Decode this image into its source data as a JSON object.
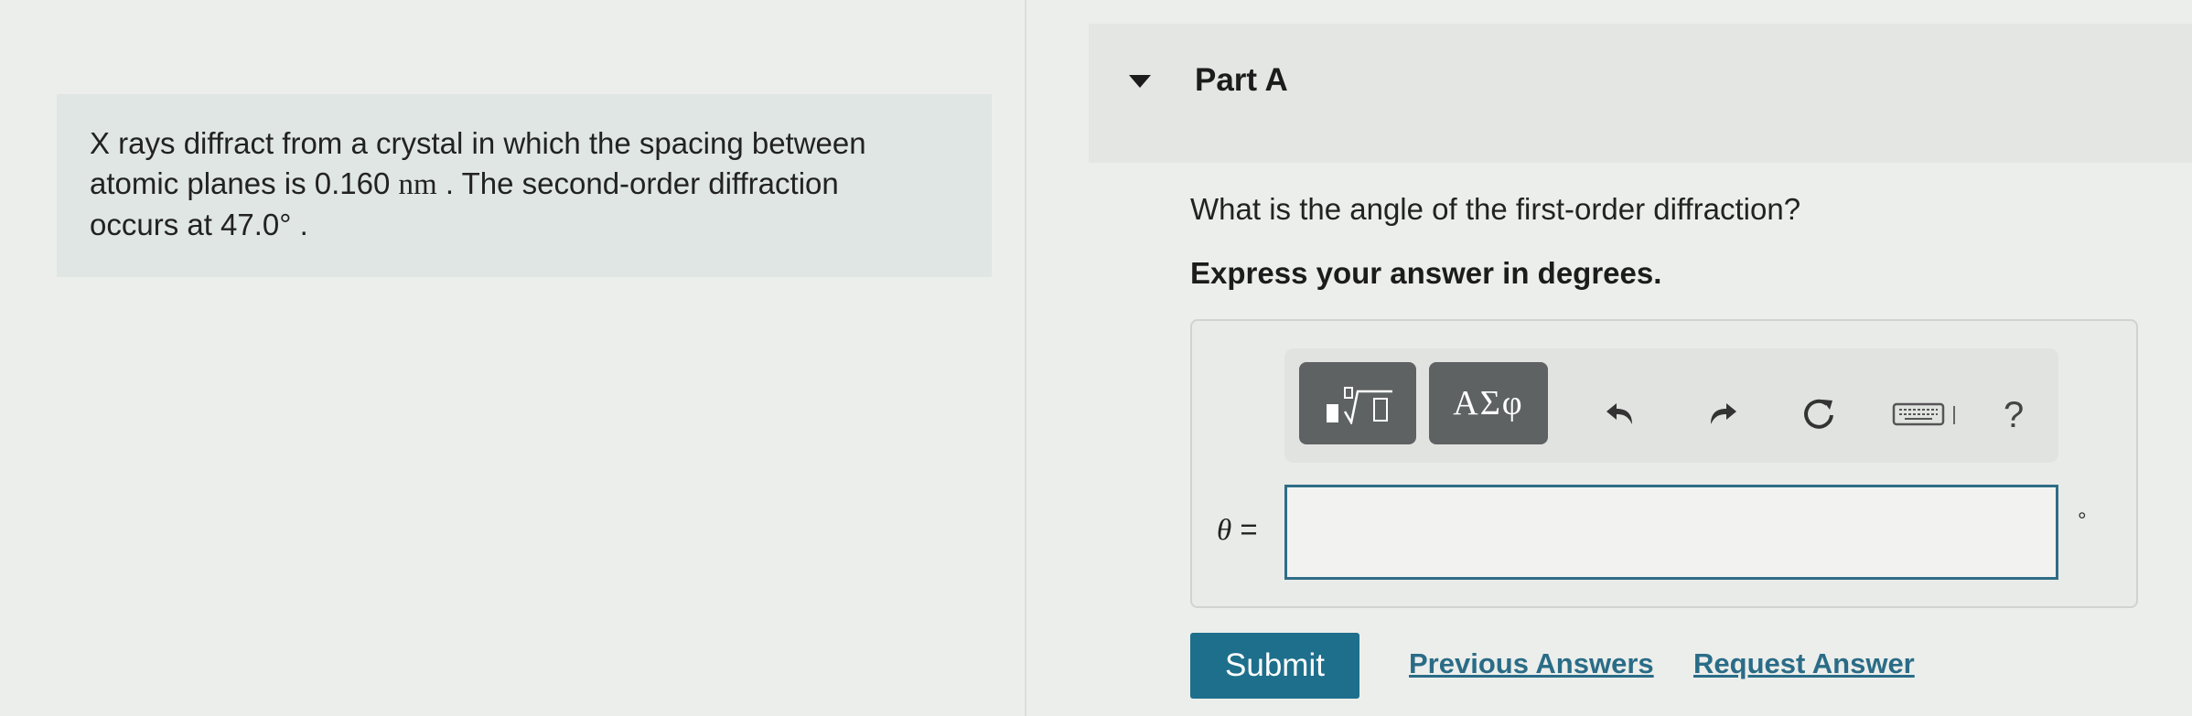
{
  "problem": {
    "line1": "X rays diffract from a crystal in which the spacing between",
    "line2_pre": "atomic planes is 0.160 ",
    "line2_unit": "nm",
    "line2_post": " . The second-order diffraction",
    "line3": "occurs at 47.0° ."
  },
  "part": {
    "title": "Part A",
    "question": "What is the angle of the first-order diffraction?",
    "instruction": "Express your answer in degrees."
  },
  "toolbar": {
    "symbols_label": "ΑΣφ",
    "help_label": "?"
  },
  "answer": {
    "variable": "θ",
    "equals": " =",
    "value": "",
    "unit": "°"
  },
  "actions": {
    "submit_label": "Submit",
    "previous_answers_label": "Previous Answers",
    "request_answer_label": "Request Answer"
  },
  "colors": {
    "accent": "#1e6f8c",
    "link": "#2a6c87",
    "problem_bg": "#dfe6e3",
    "toolbar_button": "#5e6262"
  }
}
